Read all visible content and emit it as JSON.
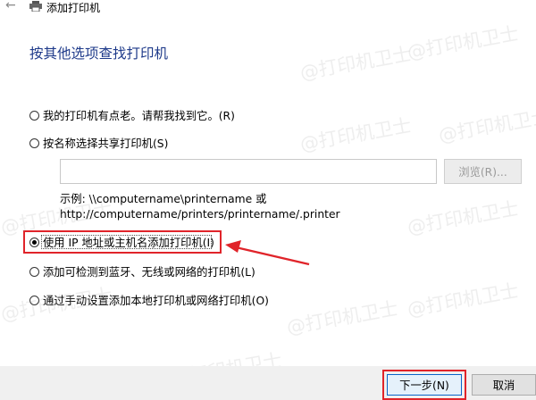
{
  "window": {
    "title": "添加打印机"
  },
  "heading": "按其他选项查找打印机",
  "options": [
    {
      "label": "我的打印机有点老。请帮我找到它。(R)",
      "selected": false
    },
    {
      "label": "按名称选择共享打印机(S)",
      "selected": false
    },
    {
      "label": "使用 IP 地址或主机名添加打印机(I)",
      "selected": true
    },
    {
      "label": "添加可检测到蓝牙、无线或网络的打印机(L)",
      "selected": false
    },
    {
      "label": "通过手动设置添加本地打印机或网络打印机(O)",
      "selected": false
    }
  ],
  "share": {
    "value": "",
    "browse_label": "浏览(R)...",
    "example_line1": "示例: \\\\computername\\printername 或",
    "example_line2": "http://computername/printers/printername/.printer"
  },
  "footer": {
    "next_label": "下一步(N)",
    "cancel_label": "取消"
  },
  "watermark": "@打印机卫士",
  "colors": {
    "heading": "#1e3a8a",
    "highlight": "#e0242a",
    "primary_border": "#0a64c8"
  }
}
